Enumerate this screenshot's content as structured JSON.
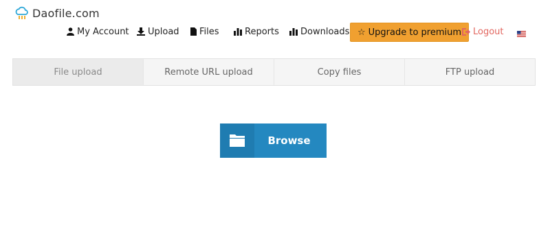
{
  "brand": {
    "name": "Daofile.com",
    "logo_icon": "cloud-logo-icon",
    "accent": "#2da7d8"
  },
  "nav": {
    "items": [
      {
        "label": "My Account",
        "icon": "user-icon"
      },
      {
        "label": "Upload",
        "icon": "upload-icon"
      },
      {
        "label": "Files",
        "icon": "file-icon"
      },
      {
        "label": "Reports",
        "icon": "bar-chart-icon"
      },
      {
        "label": "Downloads",
        "icon": "bar-chart-icon"
      }
    ],
    "premium": {
      "label": "Upgrade to premium",
      "icon": "star-icon",
      "color": "#f0a030"
    },
    "logout": {
      "label": "Logout",
      "icon": "logout-icon",
      "color": "#e2665f"
    },
    "language_icon": "us-flag-icon"
  },
  "tabs": [
    {
      "label": "File upload",
      "active": true
    },
    {
      "label": "Remote URL upload",
      "active": false
    },
    {
      "label": "Copy files",
      "active": false
    },
    {
      "label": "FTP upload",
      "active": false
    }
  ],
  "browse": {
    "label": "Browse",
    "icon": "folder-icon",
    "color": "#2488c0"
  }
}
